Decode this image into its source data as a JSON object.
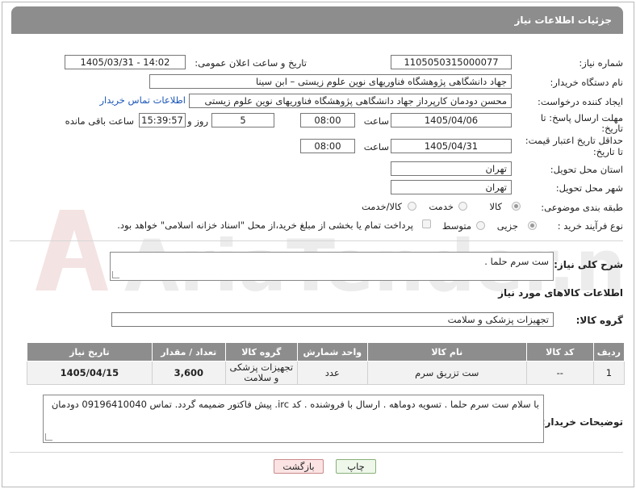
{
  "header": {
    "title": "جزئیات اطلاعات نیاز"
  },
  "fields": {
    "need_number_label": "شماره نیاز:",
    "need_number": "1105050315000077",
    "announce_label": "تاریخ و ساعت اعلان عمومی:",
    "announce_value": "1405/03/31 - 14:02",
    "buyer_org_label": "نام دستگاه خریدار:",
    "buyer_org": "جهاد دانشگاهی پژوهشگاه فناوریهای نوین علوم زیستی – ابن سینا",
    "requester_label": "ایجاد کننده درخواست:",
    "requester": "محسن دودمان کارپرداز جهاد دانشگاهی پژوهشگاه فناوریهای نوین علوم زیستی",
    "contact_link": "اطلاعات تماس خریدار",
    "reply_deadline_label_1": "مهلت ارسال پاسخ: تا",
    "reply_deadline_label_2": "تاریخ:",
    "reply_date": "1405/04/06",
    "time_label": "ساعت",
    "reply_time": "08:00",
    "days_value": "5",
    "days_label": "روز و",
    "remaining_time": "15:39:57",
    "remaining_label": "ساعت باقی مانده",
    "price_validity_label_1": "حداقل تاریخ اعتبار قیمت:",
    "price_validity_label_2": "تا تاریخ:",
    "price_date": "1405/04/31",
    "price_time": "08:00",
    "province_label": "استان محل تحویل:",
    "province": "تهران",
    "city_label": "شهر محل تحویل:",
    "city": "تهران",
    "category_label": "طبقه بندی موضوعی:",
    "category_options": [
      "کالا",
      "خدمت",
      "کالا/خدمت"
    ],
    "category_selected": "کالا",
    "process_label": "نوع فرآیند خرید :",
    "process_options": [
      "جزیی",
      "متوسط"
    ],
    "process_selected": "جزیی",
    "payment_note": "پرداخت تمام یا بخشی از مبلغ خرید،از محل \"اسناد خزانه اسلامی\" خواهد بود."
  },
  "description": {
    "label": "شرح کلی نیاز:",
    "value": "ست سرم حلما ."
  },
  "goods": {
    "section_title": "اطلاعات کالاهای مورد نیاز",
    "group_label": "گروه کالا:",
    "group_value": "تجهیزات پزشکی و سلامت"
  },
  "table": {
    "headers": [
      "ردیف",
      "کد کالا",
      "نام کالا",
      "واحد شمارش",
      "گروه کالا",
      "تعداد / مقدار",
      "تاریخ نیاز"
    ],
    "rows": [
      {
        "row": "1",
        "code": "--",
        "name": "ست تزریق سرم",
        "unit": "عدد",
        "group": "تجهیزات پزشکی و سلامت",
        "qty": "3,600",
        "date": "1405/04/15"
      }
    ]
  },
  "buyer_notes": {
    "label": "توضیحات خریدار:",
    "value": "با سلام ست سرم حلما . تسویه دوماهه . ارسال با فروشنده . کد irc. پیش فاکتور ضمیمه گردد. تماس 09196410040 دودمان"
  },
  "buttons": {
    "print": "چاپ",
    "back": "بازگشت"
  },
  "watermark": "AriaTender.neT"
}
